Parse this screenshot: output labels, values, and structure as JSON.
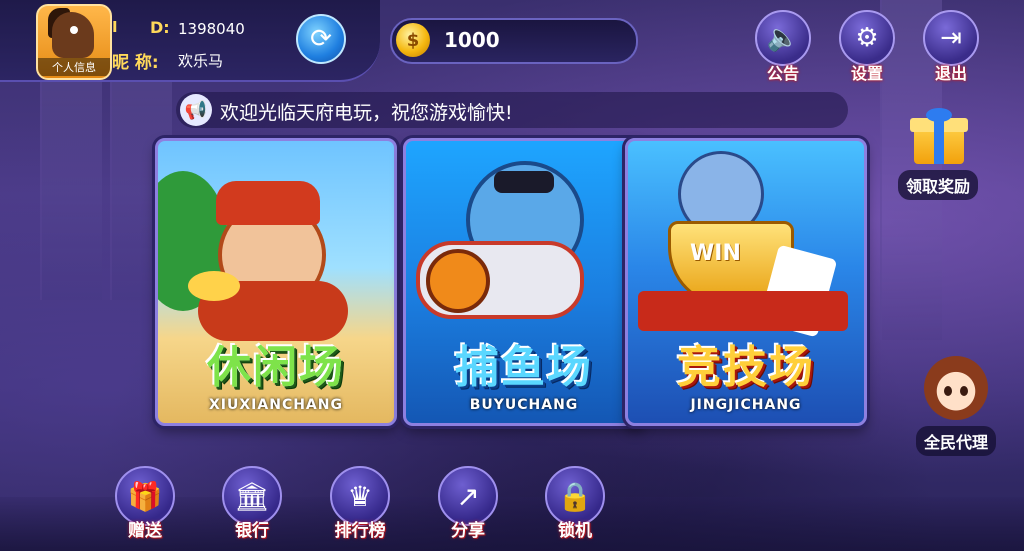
{
  "profile": {
    "avatar_label": "个人信息",
    "id_prefix": "I",
    "id_key": "D:",
    "id_value": "1398040",
    "nick_key": "昵 称:",
    "nick_value": "欢乐马"
  },
  "coins": {
    "symbol": "$",
    "value": "1000"
  },
  "top_buttons": [
    {
      "label": "公告",
      "icon": "speaker-icon"
    },
    {
      "label": "设置",
      "icon": "gear-icon"
    },
    {
      "label": "退出",
      "icon": "exit-icon"
    }
  ],
  "marquee": {
    "text": "欢迎光临天府电玩，祝您游戏愉快!"
  },
  "games": [
    {
      "title": "休闲场",
      "subtitle": "XIUXIANCHANG"
    },
    {
      "title": "捕鱼场",
      "subtitle": "BUYUCHANG"
    },
    {
      "title": "竞技场",
      "subtitle": "JINGJICHANG",
      "badge": "WIN"
    }
  ],
  "side": {
    "reward_label": "领取奖励",
    "agent_label": "全民代理"
  },
  "bottom_buttons": [
    {
      "label": "赠送",
      "icon": "gift-icon"
    },
    {
      "label": "银行",
      "icon": "bank-icon"
    },
    {
      "label": "排行榜",
      "icon": "crown-icon"
    },
    {
      "label": "分享",
      "icon": "share-icon"
    },
    {
      "label": "锁机",
      "icon": "lock-icon"
    }
  ],
  "colors": {
    "background": "#3a2f6e",
    "accent_gold": "#ffd95a",
    "button_label_outline": "#c0202a"
  }
}
